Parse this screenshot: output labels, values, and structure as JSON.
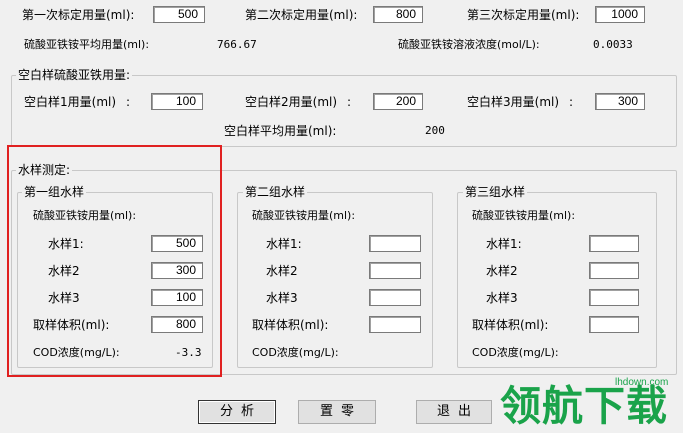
{
  "standards": {
    "first_label": "第一次标定用量(ml):",
    "first_value": "500",
    "second_label": "第二次标定用量(ml):",
    "second_value": "800",
    "third_label": "第三次标定用量(ml):",
    "third_value": "1000",
    "avg_label": "硫酸亚铁铵平均用量(ml):",
    "avg_value": "766.67",
    "conc_label": "硫酸亚铁铵溶液浓度(mol/L):",
    "conc_value": "0.0033"
  },
  "blank": {
    "title": "空白样硫酸亚铁用量:",
    "s1_label": "空白样1用量(ml)",
    "s1_value": "100",
    "s2_label": "空白样2用量(ml)",
    "s2_value": "200",
    "s3_label": "空白样3用量(ml)",
    "s3_value": "300",
    "avg_label": "空白样平均用量(ml):",
    "avg_value": "200"
  },
  "water": {
    "title": "水样测定:",
    "groups": [
      {
        "title": "第一组水样",
        "usage_label": "硫酸亚铁铵用量(ml):",
        "s1_label": "水样1:",
        "s1_value": "500",
        "s2_label": "水样2",
        "s2_value": "300",
        "s3_label": "水样3",
        "s3_value": "100",
        "vol_label": "取样体积(ml):",
        "vol_value": "800",
        "cod_label": "COD浓度(mg/L):",
        "cod_value": "-3.3"
      },
      {
        "title": "第二组水样",
        "usage_label": "硫酸亚铁铵用量(ml):",
        "s1_label": "水样1:",
        "s1_value": "",
        "s2_label": "水样2",
        "s2_value": "",
        "s3_label": "水样3",
        "s3_value": "",
        "vol_label": "取样体积(ml):",
        "vol_value": "",
        "cod_label": "COD浓度(mg/L):",
        "cod_value": ""
      },
      {
        "title": "第三组水样",
        "usage_label": "硫酸亚铁铵用量(ml):",
        "s1_label": "水样1:",
        "s1_value": "",
        "s2_label": "水样2",
        "s2_value": "",
        "s3_label": "水样3",
        "s3_value": "",
        "vol_label": "取样体积(ml):",
        "vol_value": "",
        "cod_label": "COD浓度(mg/L):",
        "cod_value": ""
      }
    ]
  },
  "buttons": {
    "analyze": "分析",
    "reset": "置零",
    "exit": "退出"
  },
  "watermark": {
    "site": "lhdown.com",
    "brand": "领航下载"
  },
  "colors": {
    "highlight_box": "#e02020",
    "watermark_green": "#1aa34a"
  }
}
